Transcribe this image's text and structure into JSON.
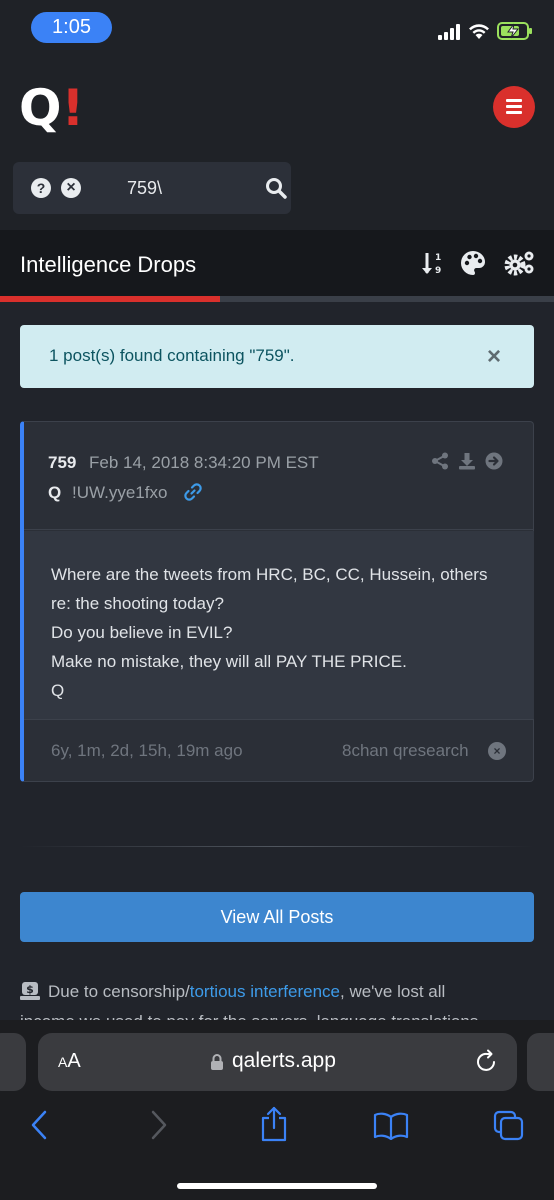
{
  "status_bar": {
    "time": "1:05"
  },
  "header": {
    "logo_q": "Q",
    "logo_bang": "!"
  },
  "search": {
    "help_icon": "?",
    "clear_icon": "×",
    "value": "759\\"
  },
  "title_bar": {
    "title": "Intelligence Drops",
    "progress_fraction": 0.397
  },
  "alert": {
    "message": "1 post(s) found containing \"759\".",
    "close_label": "×"
  },
  "post": {
    "number": "759",
    "date": "Feb 14, 2018 8:34:20 PM EST",
    "author": "Q",
    "tripcode": "!UW.yye1fxo",
    "body": [
      "Where are the tweets from HRC, BC, CC, Hussein, others",
      "re: the shooting today?",
      "Do you believe in EVIL?",
      "Make no mistake, they will all PAY THE PRICE.",
      "Q"
    ],
    "ago": "6y, 1m, 2d, 15h, 19m ago",
    "source": "8chan qresearch",
    "source_close": "×"
  },
  "view_all": {
    "label": "View All Posts"
  },
  "notice": {
    "prefix": "Due to censorship/",
    "link": "tortious interference",
    "suffix": ", we've lost all",
    "line2": "income we used to pay for the servers, language translations"
  },
  "browser": {
    "aa_big": "A",
    "aa_small": "A",
    "url": "qalerts.app"
  },
  "colors": {
    "accent_red": "#d9302c",
    "accent_blue": "#3b82f6",
    "link_blue": "#3d9be9"
  }
}
